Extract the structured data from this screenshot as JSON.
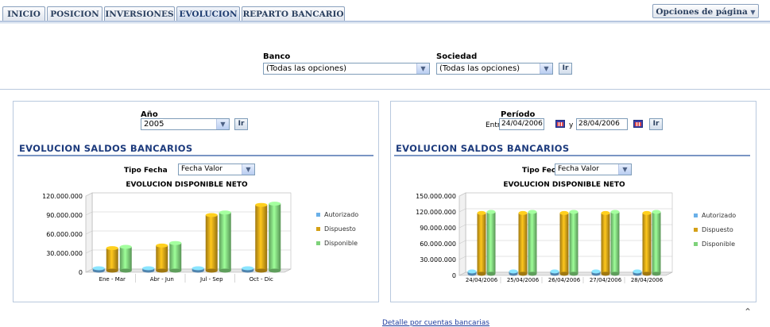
{
  "tabs": [
    "INICIO",
    "POSICION",
    "INVERSIONES",
    "EVOLUCION",
    "REPARTO BANCARIO"
  ],
  "active_tab": "EVOLUCION",
  "page_options": "Opciones de página",
  "filters": {
    "banco_label": "Banco",
    "banco_value": "(Todas las opciones)",
    "sociedad_label": "Sociedad",
    "sociedad_value": "(Todas las opciones)",
    "go": "Ir"
  },
  "left": {
    "anio_label": "Año",
    "anio_value": "2005",
    "go": "Ir",
    "section_title": "EVOLUCION SALDOS BANCARIOS",
    "tipo_label": "Tipo Fecha",
    "tipo_value": "Fecha Valor"
  },
  "right": {
    "periodo_label": "Período",
    "entre_label": "Entre",
    "from": "24/04/2006",
    "y_label": "y",
    "to": "28/04/2006",
    "go": "Ir",
    "section_title": "EVOLUCION SALDOS BANCARIOS",
    "tipo_label": "Tipo Fecha",
    "tipo_value": "Fecha Valor"
  },
  "chart_data": [
    {
      "type": "bar",
      "title": "EVOLUCION DISPONIBLE NETO",
      "categories": [
        "Ene - Mar",
        "Abr - Jun",
        "Jul - Sep",
        "Oct - Dic"
      ],
      "ylim": [
        0,
        120000000
      ],
      "yticks": [
        "0",
        "30.000.000",
        "60.000.000",
        "90.000.000",
        "120.000.000"
      ],
      "series": [
        {
          "name": "Autorizado",
          "color": "#6ab0e8",
          "values": [
            0,
            0,
            0,
            0
          ]
        },
        {
          "name": "Dispuesto",
          "color": "#d4a017",
          "values": [
            38000000,
            42000000,
            90000000,
            106000000
          ]
        },
        {
          "name": "Disponible",
          "color": "#7ed27a",
          "values": [
            40000000,
            46000000,
            94000000,
            108000000
          ]
        }
      ],
      "legend": "right"
    },
    {
      "type": "bar",
      "title": "EVOLUCION DISPONIBLE NETO",
      "categories": [
        "24/04/2006",
        "25/04/2006",
        "26/04/2006",
        "27/04/2006",
        "28/04/2006"
      ],
      "ylim": [
        0,
        150000000
      ],
      "yticks": [
        "0",
        "30.000.000",
        "60.000.000",
        "90.000.000",
        "120.000.000",
        "150.000.000"
      ],
      "series": [
        {
          "name": "Autorizado",
          "color": "#6ab0e8",
          "values": [
            0,
            0,
            0,
            0,
            0
          ]
        },
        {
          "name": "Dispuesto",
          "color": "#d4a017",
          "values": [
            118000000,
            118000000,
            118000000,
            118000000,
            118000000
          ]
        },
        {
          "name": "Disponible",
          "color": "#7ed27a",
          "values": [
            120000000,
            120000000,
            120000000,
            120000000,
            120000000
          ]
        }
      ],
      "legend": "right"
    }
  ],
  "footer_link": "Detalle por cuentas bancarias"
}
